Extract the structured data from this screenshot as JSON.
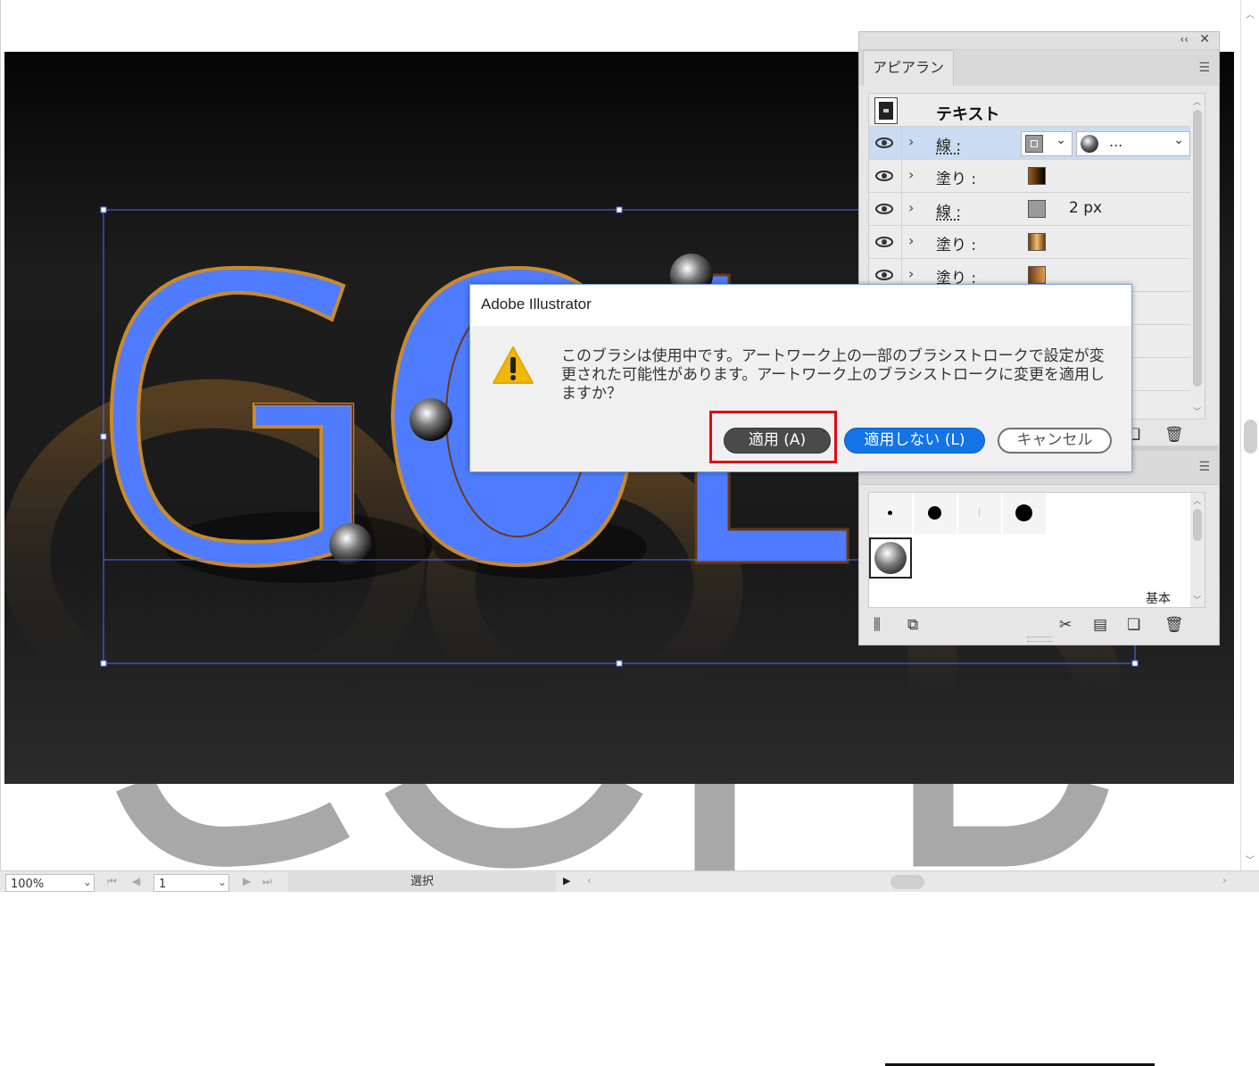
{
  "status_bar": {
    "zoom": "100%",
    "page": "1",
    "tool": "選択"
  },
  "appearance_panel": {
    "tab_label": "アピアランス",
    "object_title": "テキスト",
    "rows": [
      {
        "label": "線 :",
        "value": "..."
      },
      {
        "label": "塗り :",
        "value": ""
      },
      {
        "label": "線 :",
        "value": "2 px"
      },
      {
        "label": "塗り :",
        "value": ""
      },
      {
        "label": "塗り :",
        "value": ""
      }
    ]
  },
  "brush_panel": {
    "basic_label": "基本"
  },
  "dialog": {
    "title": "Adobe Illustrator",
    "message": "このブラシは使用中です。アートワーク上の一部のブラシストロークで設定が変更された可能性があります。アートワーク上のブラシストロークに変更を適用しますか？",
    "buttons": {
      "apply": "適用 (A)",
      "dont_apply": "適用しない (L)",
      "cancel": "キャンセル"
    }
  },
  "artwork": {
    "text": "GOLD",
    "fill_color": "#4f7cff",
    "outline_color": "#c98a2e"
  },
  "colors": {
    "highlight": "#e30613",
    "primary_button": "#1473e6",
    "selection": "#4c6ef5"
  }
}
